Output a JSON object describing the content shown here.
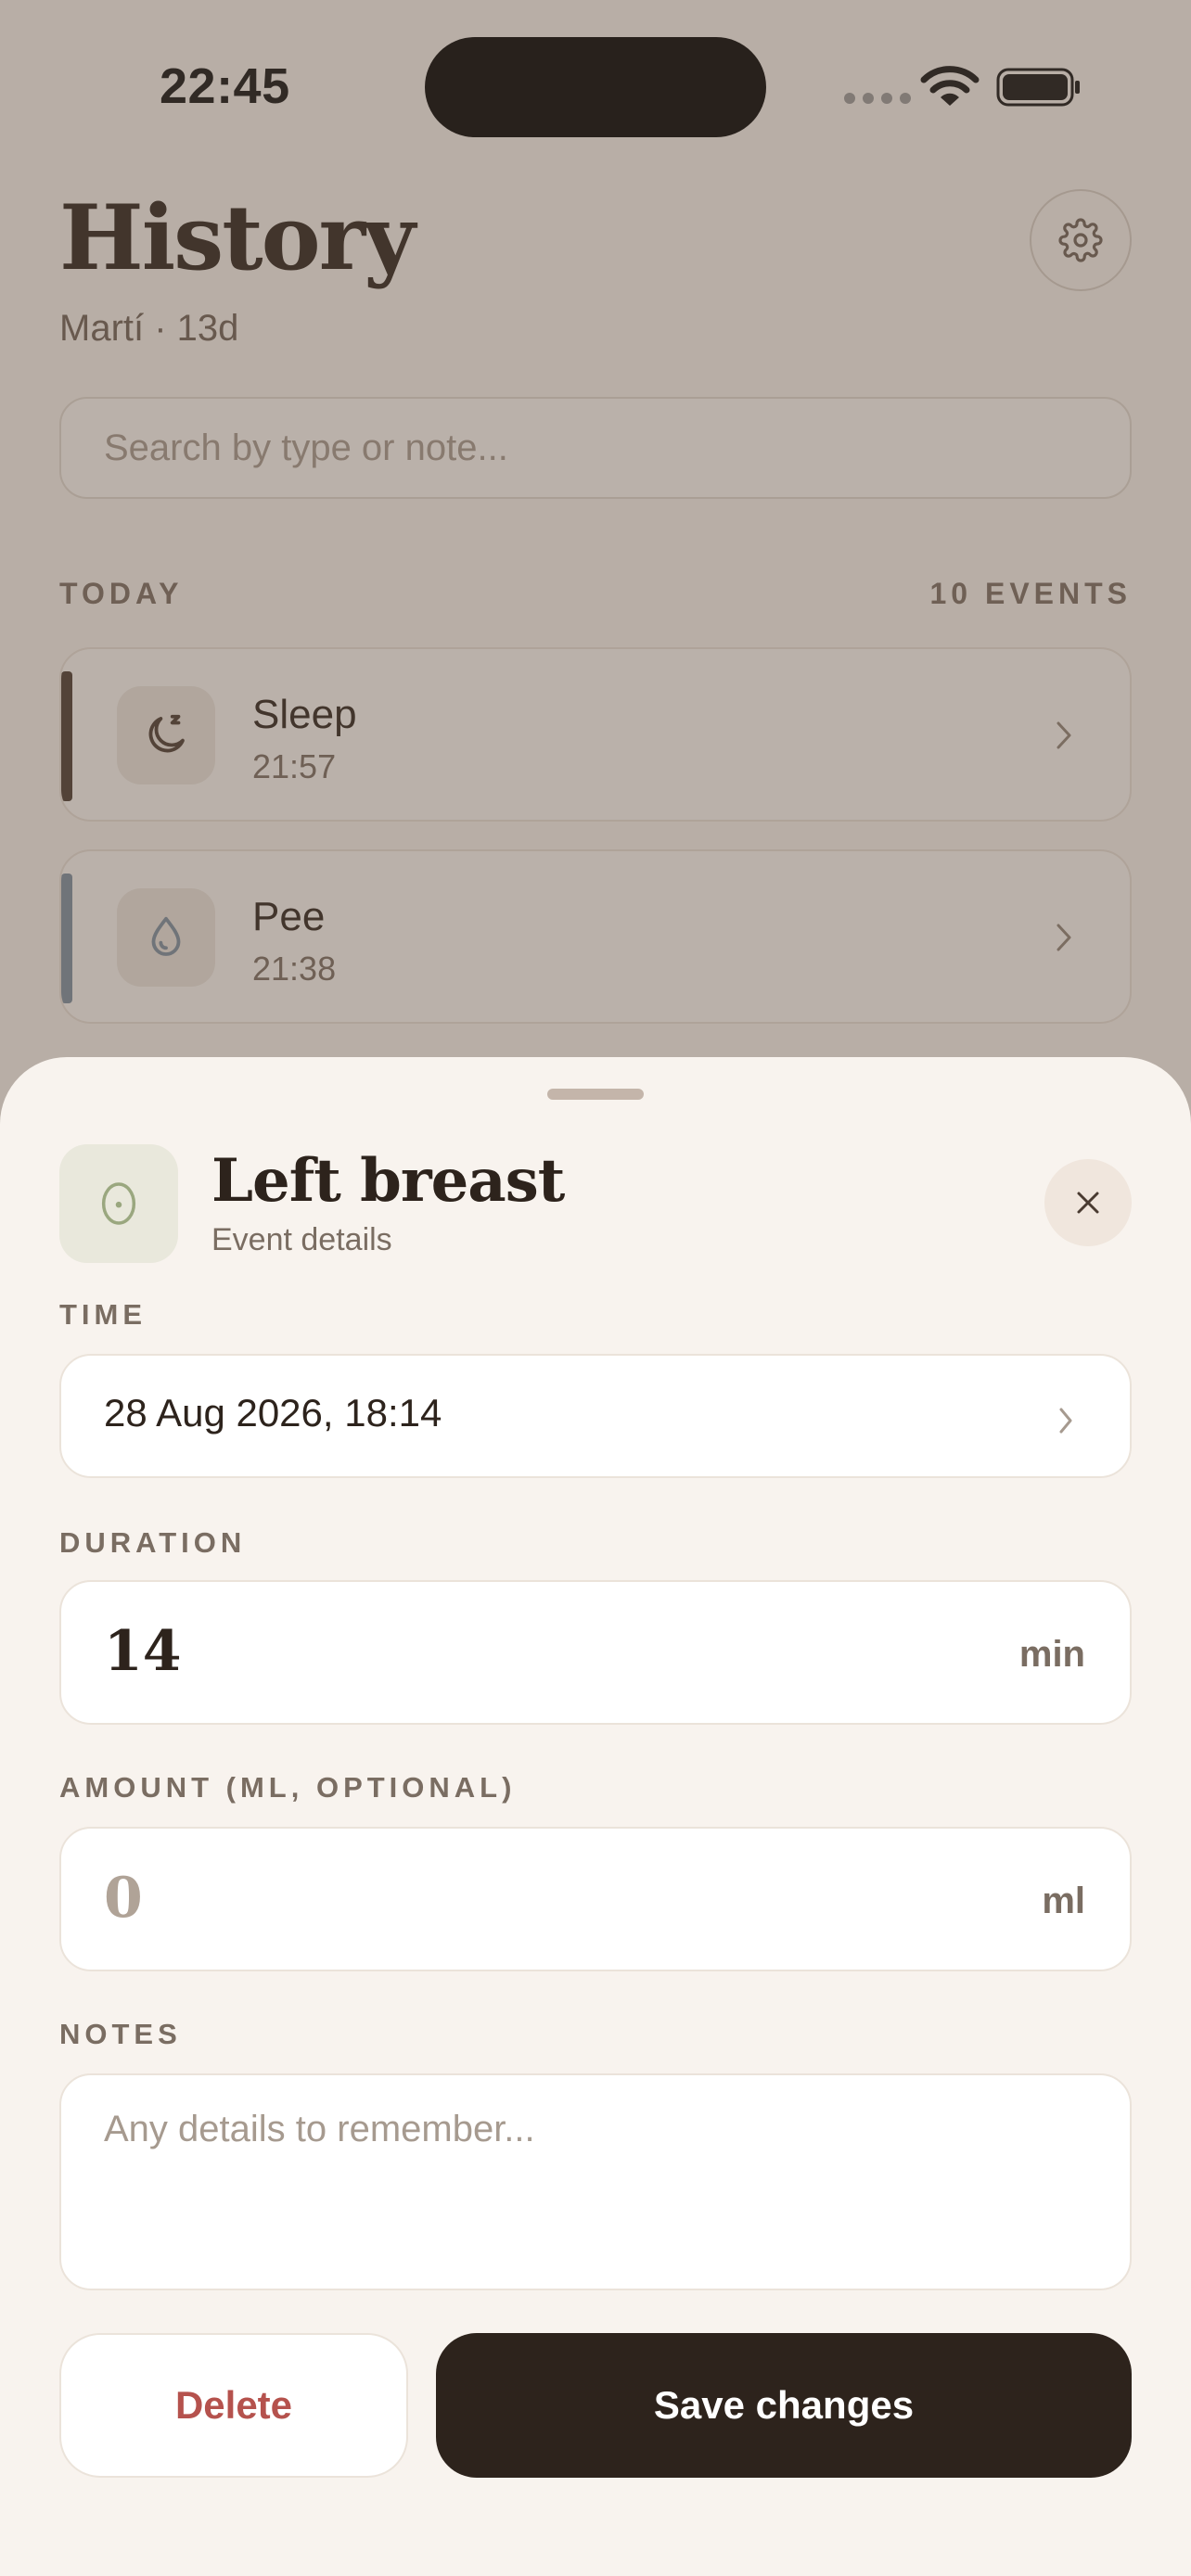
{
  "status_bar": {
    "time": "22:45"
  },
  "history": {
    "title": "History",
    "subtitle": "Martí · 13d",
    "search_placeholder": "Search by type or note...",
    "section_label": "TODAY",
    "section_count": "10 EVENTS",
    "events": [
      {
        "name": "Sleep",
        "time": "21:57",
        "icon": "moon-icon",
        "accent": "#4a3b31"
      },
      {
        "name": "Pee",
        "time": "21:38",
        "icon": "droplet-icon",
        "accent": "#7d8fa0"
      }
    ]
  },
  "sheet": {
    "icon": "breast-icon",
    "title": "Left breast",
    "subtitle": "Event details",
    "time_label": "TIME",
    "time_value": "28 Aug 2026, 18:14",
    "duration_label": "DURATION",
    "duration_value": "14",
    "duration_unit": "min",
    "amount_label": "AMOUNT (ML, OPTIONAL)",
    "amount_value": "0",
    "amount_unit": "ml",
    "notes_label": "NOTES",
    "notes_placeholder": "Any details to remember...",
    "delete_label": "Delete",
    "save_label": "Save changes"
  },
  "colors": {
    "background": "#f8f3ee",
    "primary_dark": "#2d231c",
    "danger": "#b5524d",
    "type_icon_bg": "#e9e8dc",
    "type_icon_stroke": "#9aa77f"
  }
}
